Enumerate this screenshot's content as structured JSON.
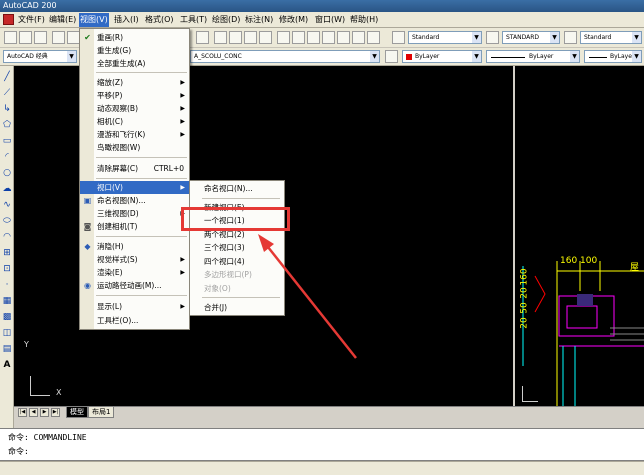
{
  "window": {
    "title": "AutoCAD 200"
  },
  "menubar": {
    "items": [
      {
        "label": "文件(F)"
      },
      {
        "label": "编辑(E)"
      },
      {
        "label": "视图(V)"
      },
      {
        "label": "插入(I)"
      },
      {
        "label": "格式(O)"
      },
      {
        "label": "工具(T)"
      },
      {
        "label": "绘图(D)"
      },
      {
        "label": "标注(N)"
      },
      {
        "label": "修改(M)"
      },
      {
        "label": "窗口(W)"
      },
      {
        "label": "帮助(H)"
      }
    ],
    "active": "视图(V)"
  },
  "toolbar": {
    "text_style": "Standard",
    "dim_style": "STANDARD",
    "table_style": "Standard",
    "workspace": "AutoCAD 经典",
    "layer": "A_SCOLU_CONC",
    "color": "ByLayer",
    "linetype": "ByLayer",
    "lineweight": "ByLayer",
    "color_swatch": "#e00000"
  },
  "view_menu": {
    "items": [
      {
        "label": "重画(R)",
        "icon": "pencil-check-icon"
      },
      {
        "label": "重生成(G)"
      },
      {
        "label": "全部重生成(A)"
      },
      {
        "label": "缩放(Z)",
        "submenu": true
      },
      {
        "label": "平移(P)",
        "submenu": true
      },
      {
        "label": "动态观察(B)",
        "submenu": true
      },
      {
        "label": "相机(C)",
        "submenu": true
      },
      {
        "label": "漫游和飞行(K)",
        "submenu": true
      },
      {
        "label": "鸟瞰视图(W)"
      },
      {
        "label": "清除屏幕(C)",
        "shortcut": "CTRL+0"
      },
      {
        "label": "视口(V)",
        "submenu": true,
        "highlighted": true
      },
      {
        "label": "命名视图(N)...",
        "icon": "named-view-icon"
      },
      {
        "label": "三维视图(D)",
        "submenu": true
      },
      {
        "label": "创建相机(T)",
        "icon": "camera-icon"
      },
      {
        "label": "消隐(H)",
        "icon": "hide-icon"
      },
      {
        "label": "视觉样式(S)",
        "submenu": true
      },
      {
        "label": "渲染(E)",
        "submenu": true
      },
      {
        "label": "运动路径动画(M)...",
        "icon": "motion-path-icon"
      },
      {
        "label": "显示(L)",
        "submenu": true
      },
      {
        "label": "工具栏(O)..."
      }
    ]
  },
  "viewport_submenu": {
    "items": [
      {
        "label": "命名视口(N)..."
      },
      {
        "label": "新建视口(E)..."
      },
      {
        "label": "一个视口(1)"
      },
      {
        "label": "两个视口(2)"
      },
      {
        "label": "三个视口(3)"
      },
      {
        "label": "四个视口(4)"
      },
      {
        "label": "多边形视口(P)",
        "disabled": true
      },
      {
        "label": "对象(O)",
        "disabled": true
      },
      {
        "label": "合并(J)"
      }
    ]
  },
  "drawing": {
    "dims": [
      "160",
      "100",
      "50",
      "20",
      "160",
      "20",
      "屋"
    ],
    "ucs": {
      "x_label": "X",
      "y_label": "Y"
    }
  },
  "layout_tabs": [
    {
      "label": "模型"
    },
    {
      "label": "布局1"
    }
  ],
  "command": {
    "line1": "命令: COMMANDLINE",
    "line2": "命令:"
  },
  "annotation": {
    "highlight_color": "#e53935"
  }
}
